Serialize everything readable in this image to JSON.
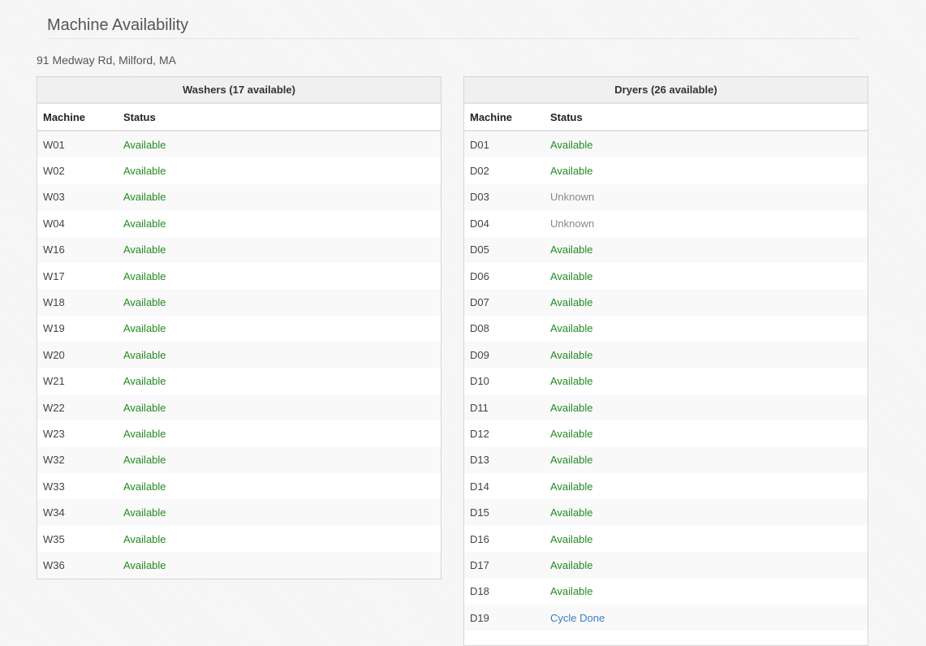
{
  "page": {
    "title": "Machine Availability",
    "address": "91 Medway Rd, Milford, MA"
  },
  "colors": {
    "available": "#228b22",
    "unknown": "#888888",
    "cycle_done": "#3a7fbf"
  },
  "washers": {
    "heading": "Washers (17 available)",
    "columns": [
      "Machine",
      "Status"
    ],
    "rows": [
      {
        "machine": "W01",
        "status": "Available"
      },
      {
        "machine": "W02",
        "status": "Available"
      },
      {
        "machine": "W03",
        "status": "Available"
      },
      {
        "machine": "W04",
        "status": "Available"
      },
      {
        "machine": "W16",
        "status": "Available"
      },
      {
        "machine": "W17",
        "status": "Available"
      },
      {
        "machine": "W18",
        "status": "Available"
      },
      {
        "machine": "W19",
        "status": "Available"
      },
      {
        "machine": "W20",
        "status": "Available"
      },
      {
        "machine": "W21",
        "status": "Available"
      },
      {
        "machine": "W22",
        "status": "Available"
      },
      {
        "machine": "W23",
        "status": "Available"
      },
      {
        "machine": "W32",
        "status": "Available"
      },
      {
        "machine": "W33",
        "status": "Available"
      },
      {
        "machine": "W34",
        "status": "Available"
      },
      {
        "machine": "W35",
        "status": "Available"
      },
      {
        "machine": "W36",
        "status": "Available"
      }
    ]
  },
  "dryers": {
    "heading": "Dryers (26 available)",
    "columns": [
      "Machine",
      "Status"
    ],
    "rows": [
      {
        "machine": "D01",
        "status": "Available"
      },
      {
        "machine": "D02",
        "status": "Available"
      },
      {
        "machine": "D03",
        "status": "Unknown"
      },
      {
        "machine": "D04",
        "status": "Unknown"
      },
      {
        "machine": "D05",
        "status": "Available"
      },
      {
        "machine": "D06",
        "status": "Available"
      },
      {
        "machine": "D07",
        "status": "Available"
      },
      {
        "machine": "D08",
        "status": "Available"
      },
      {
        "machine": "D09",
        "status": "Available"
      },
      {
        "machine": "D10",
        "status": "Available"
      },
      {
        "machine": "D11",
        "status": "Available"
      },
      {
        "machine": "D12",
        "status": "Available"
      },
      {
        "machine": "D13",
        "status": "Available"
      },
      {
        "machine": "D14",
        "status": "Available"
      },
      {
        "machine": "D15",
        "status": "Available"
      },
      {
        "machine": "D16",
        "status": "Available"
      },
      {
        "machine": "D17",
        "status": "Available"
      },
      {
        "machine": "D18",
        "status": "Available"
      },
      {
        "machine": "D19",
        "status": "Cycle Done"
      }
    ]
  }
}
